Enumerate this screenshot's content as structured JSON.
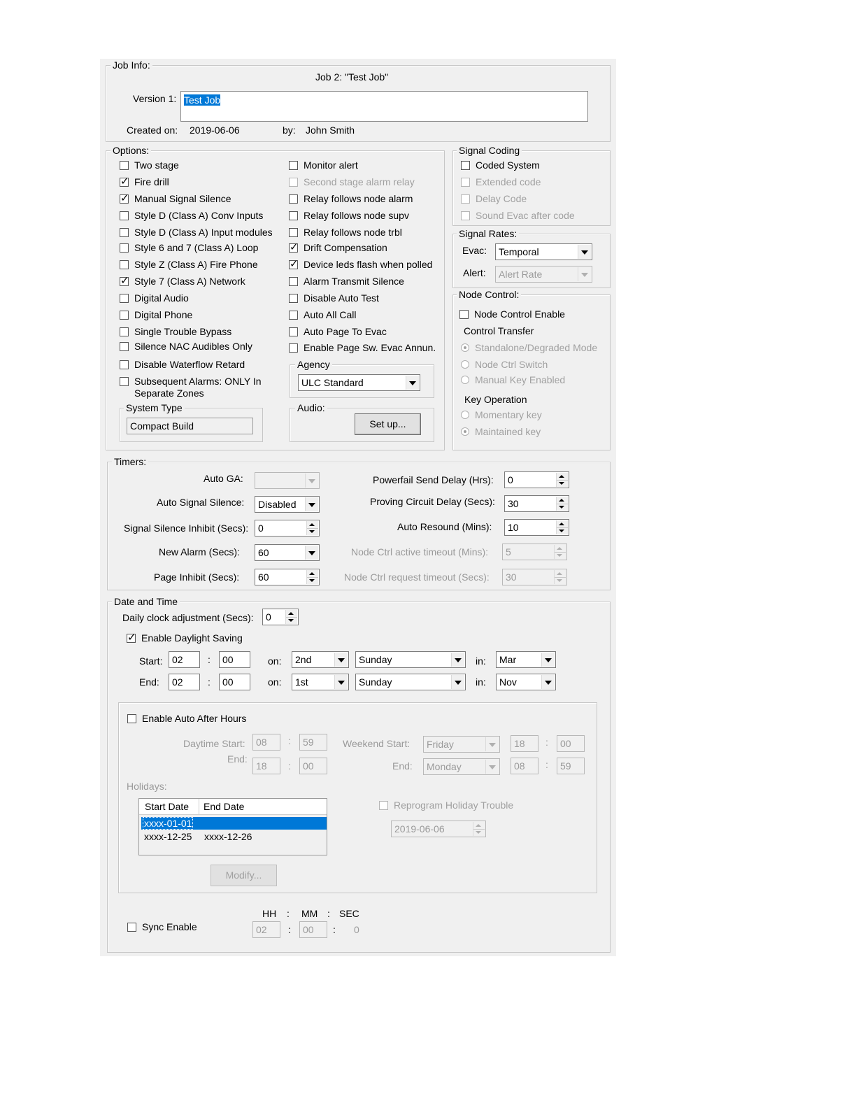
{
  "job_info": {
    "title": "Job Info:",
    "job_label": "Job 2:  \"Test Job\"",
    "version_label": "Version 1:",
    "version_value": "Test Job",
    "created_label": "Created on:",
    "created_value": "2019-06-06",
    "by_label": "by:",
    "by_value": "John Smith"
  },
  "options": {
    "title": "Options:",
    "left": [
      {
        "label": "Two stage",
        "checked": false
      },
      {
        "label": "Fire drill",
        "checked": true
      },
      {
        "label": "Manual Signal Silence",
        "checked": true
      },
      {
        "label": "Style D (Class A) Conv Inputs",
        "checked": false
      },
      {
        "label": "Style D (Class A) Input modules",
        "checked": false
      },
      {
        "label": "Style 6 and 7 (Class A) Loop",
        "checked": false
      },
      {
        "label": "Style Z (Class A) Fire Phone",
        "checked": false
      },
      {
        "label": "Style 7 (Class A) Network",
        "checked": true
      },
      {
        "label": "Digital Audio",
        "checked": false
      },
      {
        "label": "Digital Phone",
        "checked": false
      },
      {
        "label": "Single Trouble Bypass",
        "checked": false
      },
      {
        "label": "Silence NAC Audibles Only",
        "checked": false
      },
      {
        "label": "Disable Waterflow Retard",
        "checked": false
      },
      {
        "label": "Subsequent Alarms: ONLY In Separate Zones",
        "checked": false
      }
    ],
    "right": [
      {
        "label": "Monitor alert",
        "checked": false
      },
      {
        "label": "Second stage alarm relay",
        "checked": false
      },
      {
        "label": "Relay follows node alarm",
        "checked": false
      },
      {
        "label": "Relay follows node supv",
        "checked": false
      },
      {
        "label": "Relay follows node trbl",
        "checked": false
      },
      {
        "label": "Drift Compensation",
        "checked": true
      },
      {
        "label": "Device leds flash when polled",
        "checked": true
      },
      {
        "label": "Alarm Transmit Silence",
        "checked": false
      },
      {
        "label": "Disable Auto Test",
        "checked": false
      },
      {
        "label": "Auto All Call",
        "checked": false
      },
      {
        "label": "Auto Page To Evac",
        "checked": false
      },
      {
        "label": "Enable Page Sw. Evac Annun.",
        "checked": false
      }
    ],
    "system_type_title": "System Type",
    "system_type_value": "Compact Build",
    "agency_title": "Agency",
    "agency_value": "ULC Standard",
    "audio_title": "Audio:",
    "setup_button": "Set up..."
  },
  "signal_coding": {
    "title": "Signal Coding",
    "items": [
      {
        "label": "Coded System",
        "checked": false
      },
      {
        "label": "Extended code",
        "checked": false
      },
      {
        "label": "Delay Code",
        "checked": false
      },
      {
        "label": "Sound Evac after code",
        "checked": false
      }
    ]
  },
  "signal_rates": {
    "title": "Signal Rates:",
    "evac_label": "Evac:",
    "evac_value": "Temporal",
    "alert_label": "Alert:",
    "alert_value": "Alert Rate"
  },
  "node_control": {
    "title": "Node Control:",
    "enable_label": "Node Control Enable",
    "enable_checked": false,
    "control_transfer": "Control Transfer",
    "transfer_options": [
      {
        "label": "Standalone/Degraded Mode",
        "selected": true
      },
      {
        "label": "Node Ctrl Switch",
        "selected": false
      },
      {
        "label": "Manual Key Enabled",
        "selected": false
      }
    ],
    "key_operation": "Key Operation",
    "key_options": [
      {
        "label": "Momentary key",
        "selected": false
      },
      {
        "label": "Maintained key",
        "selected": true
      }
    ]
  },
  "timers": {
    "title": "Timers:",
    "auto_ga_label": "Auto GA:",
    "auto_ga_value": "",
    "auto_signal_silence_label": "Auto Signal Silence:",
    "auto_signal_silence_value": "Disabled",
    "signal_silence_inhibit_label": "Signal Silence Inhibit (Secs):",
    "signal_silence_inhibit_value": "0",
    "new_alarm_label": "New Alarm (Secs):",
    "new_alarm_value": "60",
    "page_inhibit_label": "Page Inhibit (Secs):",
    "page_inhibit_value": "60",
    "powerfail_label": "Powerfail Send Delay (Hrs):",
    "powerfail_value": "0",
    "proving_label": "Proving Circuit Delay (Secs):",
    "proving_value": "30",
    "auto_resound_label": "Auto Resound (Mins):",
    "auto_resound_value": "10",
    "node_active_label": "Node Ctrl active timeout (Mins):",
    "node_active_value": "5",
    "node_request_label": "Node Ctrl request timeout (Secs):",
    "node_request_value": "30"
  },
  "date_time": {
    "title": "Date and Time",
    "daily_label": "Daily clock adjustment (Secs):",
    "daily_value": "0",
    "dst_label": "Enable Daylight Saving",
    "dst_checked": true,
    "start_label": "Start:",
    "start_hh": "02",
    "start_mm": "00",
    "start_week": "2nd",
    "start_day": "Sunday",
    "start_month": "Mar",
    "end_label": "End:",
    "end_hh": "02",
    "end_mm": "00",
    "end_week": "1st",
    "end_day": "Sunday",
    "end_month": "Nov",
    "on_label": "on:",
    "in_label": "in:",
    "colon": ":"
  },
  "after_hours": {
    "enable_label": "Enable Auto After Hours",
    "enable_checked": false,
    "daytime_start_label": "Daytime Start:",
    "daytime_start_hh": "08",
    "daytime_start_mm": "59",
    "daytime_end_label": "End:",
    "daytime_end_hh": "18",
    "daytime_end_mm": "00",
    "weekend_start_label": "Weekend Start:",
    "weekend_start_day": "Friday",
    "weekend_start_hh": "18",
    "weekend_start_mm": "00",
    "weekend_end_label": "End:",
    "weekend_end_day": "Monday",
    "weekend_end_hh": "08",
    "weekend_end_mm": "59",
    "holidays_label": "Holidays:",
    "holidays_columns": [
      "Start Date",
      "End Date"
    ],
    "holidays_rows": [
      {
        "start": "xxxx-01-01",
        "end": ""
      },
      {
        "start": "xxxx-12-25",
        "end": "xxxx-12-26"
      }
    ],
    "reprogram_label": "Reprogram Holiday Trouble",
    "reprogram_checked": false,
    "reprogram_date": "2019-06-06",
    "modify_button": "Modify..."
  },
  "sync": {
    "hh_label": "HH",
    "mm_label": "MM",
    "sec_label": "SEC",
    "colon": ":",
    "enable_label": "Sync Enable",
    "enable_checked": false,
    "hh_value": "02",
    "mm_value": "00",
    "sec_value": "0"
  }
}
